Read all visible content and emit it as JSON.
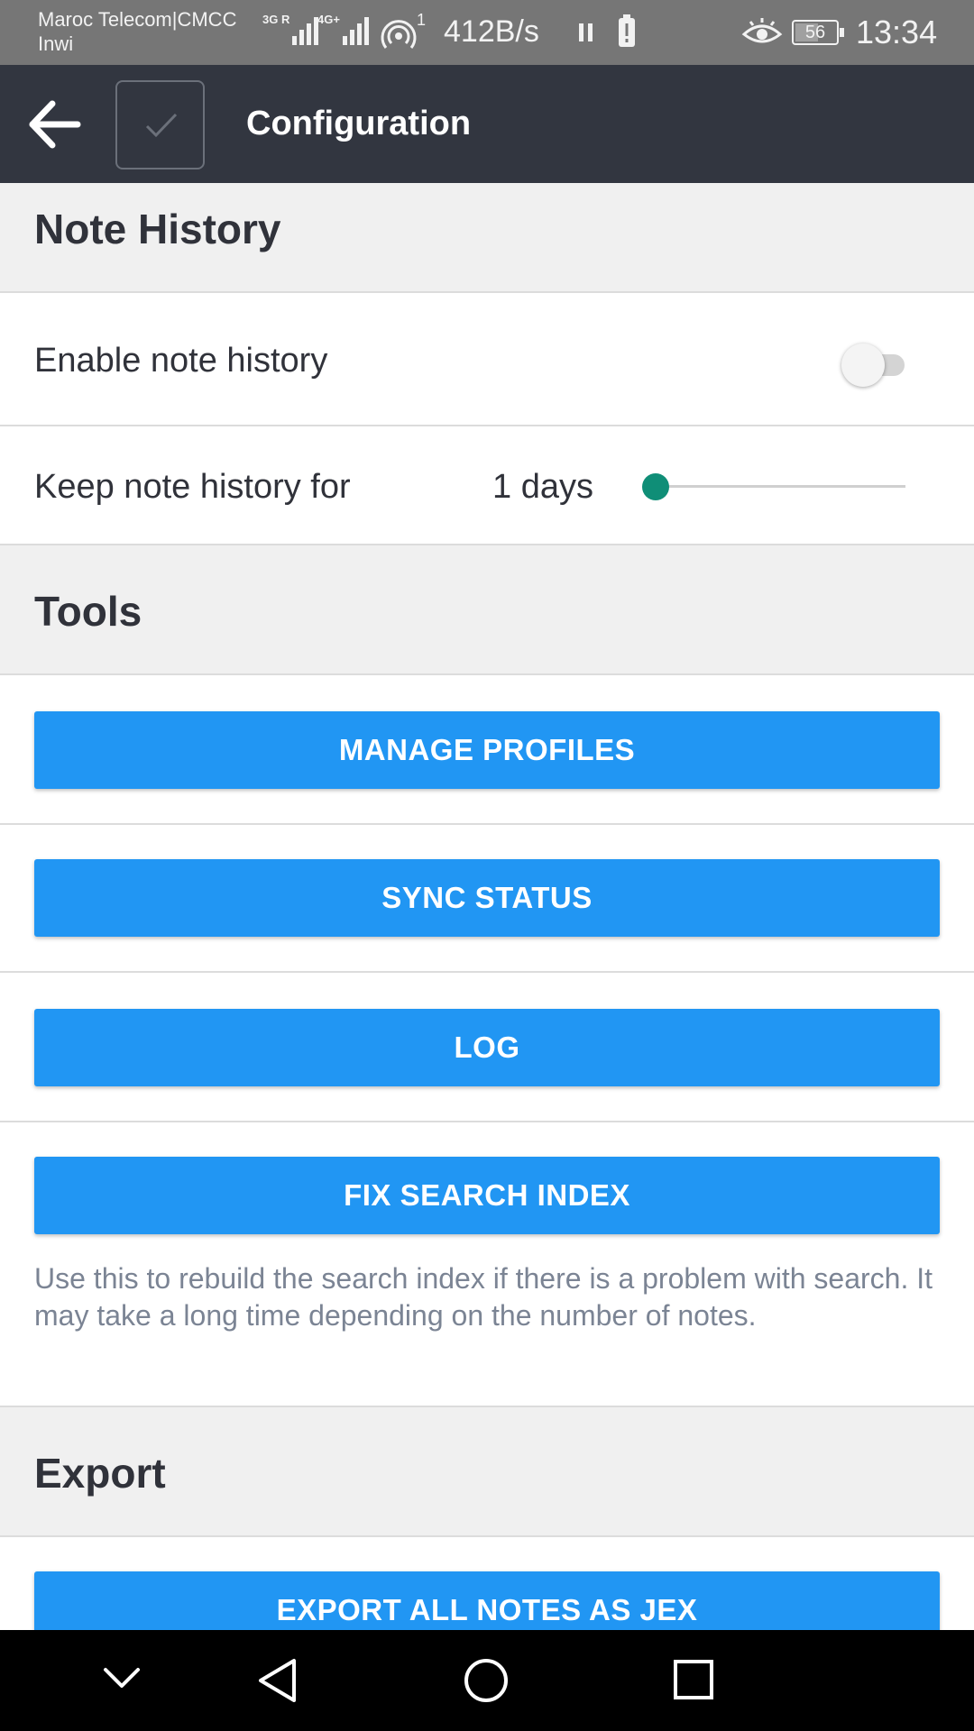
{
  "status_bar": {
    "carrier_1": "Maroc Telecom|CMCC",
    "carrier_2": "Inwi",
    "net_1": "3G R",
    "net_2": "4G+",
    "hotspot_count": "1",
    "speed": "412B/s",
    "battery": "56",
    "time": "13:34"
  },
  "header": {
    "title": "Configuration",
    "back_icon": "arrow-left-icon",
    "save_icon": "checkmark-icon"
  },
  "sections": {
    "note_history": {
      "title": "Note History",
      "enable_label": "Enable note history",
      "enable_on": false,
      "keep_label": "Keep note history for",
      "keep_value": "1 days",
      "keep_slider_fraction": 0.0
    },
    "tools": {
      "title": "Tools",
      "manage_profiles": "MANAGE PROFILES",
      "sync_status": "SYNC STATUS",
      "log": "LOG",
      "fix_search_index": "FIX SEARCH INDEX",
      "fix_search_help": "Use this to rebuild the search index if there is a problem with search. It may take a long time depending on the number of notes."
    },
    "export": {
      "title": "Export",
      "export_jex": "EXPORT ALL NOTES AS JEX"
    }
  },
  "nav_bar": {
    "icons": [
      "chevron-down-icon",
      "back-triangle-icon",
      "home-circle-icon",
      "recents-square-icon"
    ]
  },
  "colors": {
    "app_bar": "#323640",
    "button": "#2196f3",
    "slider_thumb": "#0f8e77",
    "section_bg": "#f0f0f0"
  }
}
